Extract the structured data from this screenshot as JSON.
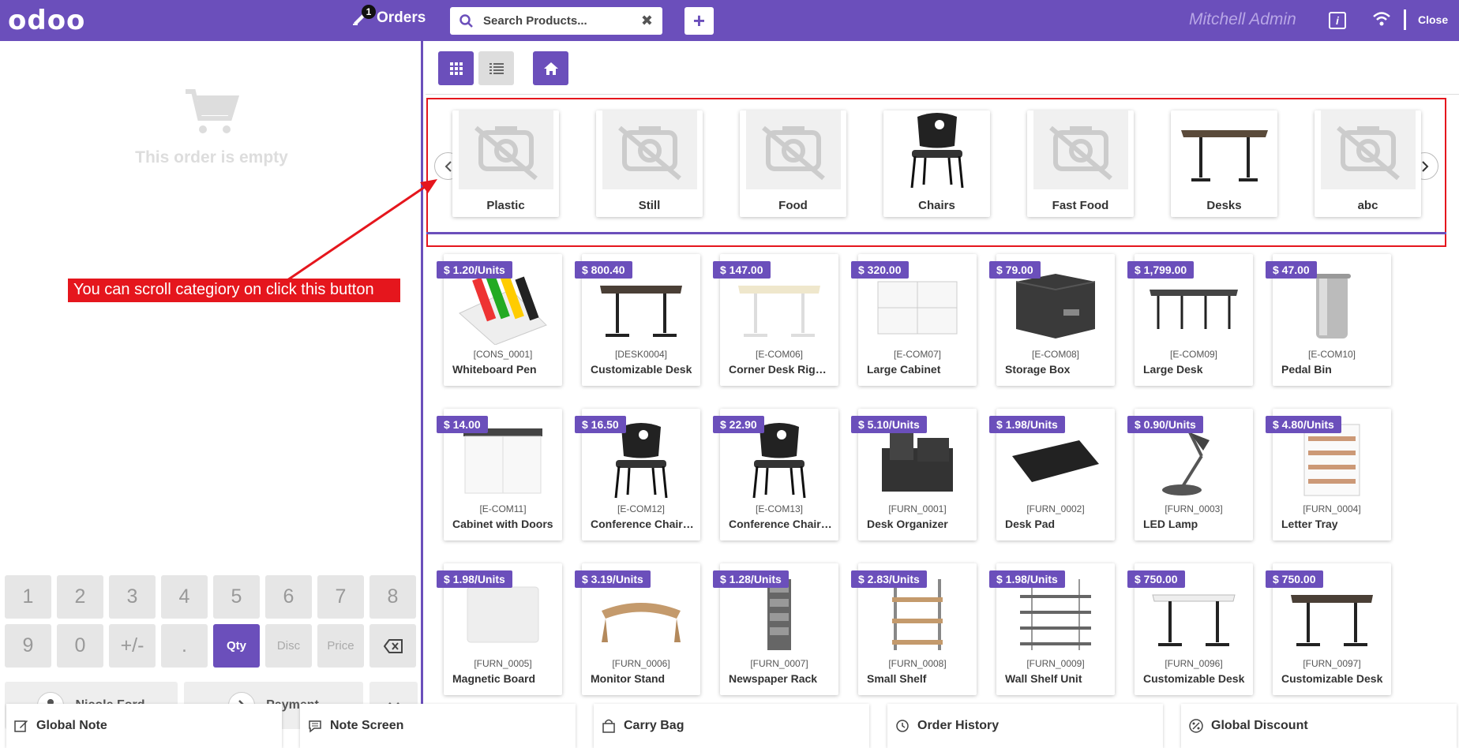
{
  "header": {
    "logo": "odoo",
    "orders_label": "Orders",
    "orders_count": "1",
    "search_placeholder": "Search Products...",
    "user_name": "Mitchell Admin",
    "close_label": "Close"
  },
  "order": {
    "empty_text": "This order is empty"
  },
  "annotation": "You can scroll categiory on click this button",
  "numpad": {
    "keys": [
      "1",
      "2",
      "3",
      "4",
      "5",
      "6",
      "7",
      "8",
      "9",
      "0",
      "+/-",
      ".",
      "Qty",
      "Disc",
      "Price"
    ],
    "active": "Qty"
  },
  "actions": {
    "customer": "Nicole Ford",
    "payment": "Payment"
  },
  "categories": [
    {
      "label": "Plastic",
      "image": "no-image"
    },
    {
      "label": "Still",
      "image": "no-image"
    },
    {
      "label": "Food",
      "image": "no-image"
    },
    {
      "label": "Chairs",
      "image": "chair"
    },
    {
      "label": "Fast Food",
      "image": "no-image"
    },
    {
      "label": "Desks",
      "image": "desk"
    },
    {
      "label": "abc",
      "image": "no-image"
    }
  ],
  "products": [
    {
      "price": "$ 1.20/Units",
      "code": "[CONS_0001]",
      "name": "Whiteboard Pen",
      "image": "pens"
    },
    {
      "price": "$ 800.40",
      "code": "[DESK0004]",
      "name": "Customizable Desk",
      "image": "desk-dark"
    },
    {
      "price": "$ 147.00",
      "code": "[E-COM06]",
      "name": "Corner Desk Right Sit",
      "image": "desk-light"
    },
    {
      "price": "$ 320.00",
      "code": "[E-COM07]",
      "name": "Large Cabinet",
      "image": "cabinet"
    },
    {
      "price": "$ 79.00",
      "code": "[E-COM08]",
      "name": "Storage Box",
      "image": "box"
    },
    {
      "price": "$ 1,799.00",
      "code": "[E-COM09]",
      "name": "Large Desk",
      "image": "large-desk"
    },
    {
      "price": "$ 47.00",
      "code": "[E-COM10]",
      "name": "Pedal Bin",
      "image": "bin"
    },
    {
      "price": "$ 14.00",
      "code": "[E-COM11]",
      "name": "Cabinet with Doors",
      "image": "cabinet-doors"
    },
    {
      "price": "$ 16.50",
      "code": "[E-COM12]",
      "name": "Conference Chair (Steel)",
      "image": "chair"
    },
    {
      "price": "$ 22.90",
      "code": "[E-COM13]",
      "name": "Conference Chair (Aluminium)",
      "image": "chair"
    },
    {
      "price": "$ 5.10/Units",
      "code": "[FURN_0001]",
      "name": "Desk Organizer",
      "image": "organizer"
    },
    {
      "price": "$ 1.98/Units",
      "code": "[FURN_0002]",
      "name": "Desk Pad",
      "image": "pad"
    },
    {
      "price": "$ 0.90/Units",
      "code": "[FURN_0003]",
      "name": "LED Lamp",
      "image": "lamp"
    },
    {
      "price": "$ 4.80/Units",
      "code": "[FURN_0004]",
      "name": "Letter Tray",
      "image": "tray"
    },
    {
      "price": "$ 1.98/Units",
      "code": "[FURN_0005]",
      "name": "Magnetic Board",
      "image": "board"
    },
    {
      "price": "$ 3.19/Units",
      "code": "[FURN_0006]",
      "name": "Monitor Stand",
      "image": "stand"
    },
    {
      "price": "$ 1.28/Units",
      "code": "[FURN_0007]",
      "name": "Newspaper Rack",
      "image": "rack"
    },
    {
      "price": "$ 2.83/Units",
      "code": "[FURN_0008]",
      "name": "Small Shelf",
      "image": "shelf"
    },
    {
      "price": "$ 1.98/Units",
      "code": "[FURN_0009]",
      "name": "Wall Shelf Unit",
      "image": "wall-shelf"
    },
    {
      "price": "$ 750.00",
      "code": "[FURN_0096]",
      "name": "Customizable Desk",
      "image": "desk-white"
    },
    {
      "price": "$ 750.00",
      "code": "[FURN_0097]",
      "name": "Customizable Desk",
      "image": "desk-dark"
    }
  ],
  "footer": [
    {
      "label": "Global Note",
      "icon": "edit-icon"
    },
    {
      "label": "Note Screen",
      "icon": "note-icon"
    },
    {
      "label": "Carry Bag",
      "icon": "bag-icon"
    },
    {
      "label": "Order History",
      "icon": "history-icon"
    },
    {
      "label": "Global Discount",
      "icon": "discount-icon"
    }
  ],
  "colors": {
    "accent": "#6b4fbb",
    "annotation": "#e5161d"
  }
}
